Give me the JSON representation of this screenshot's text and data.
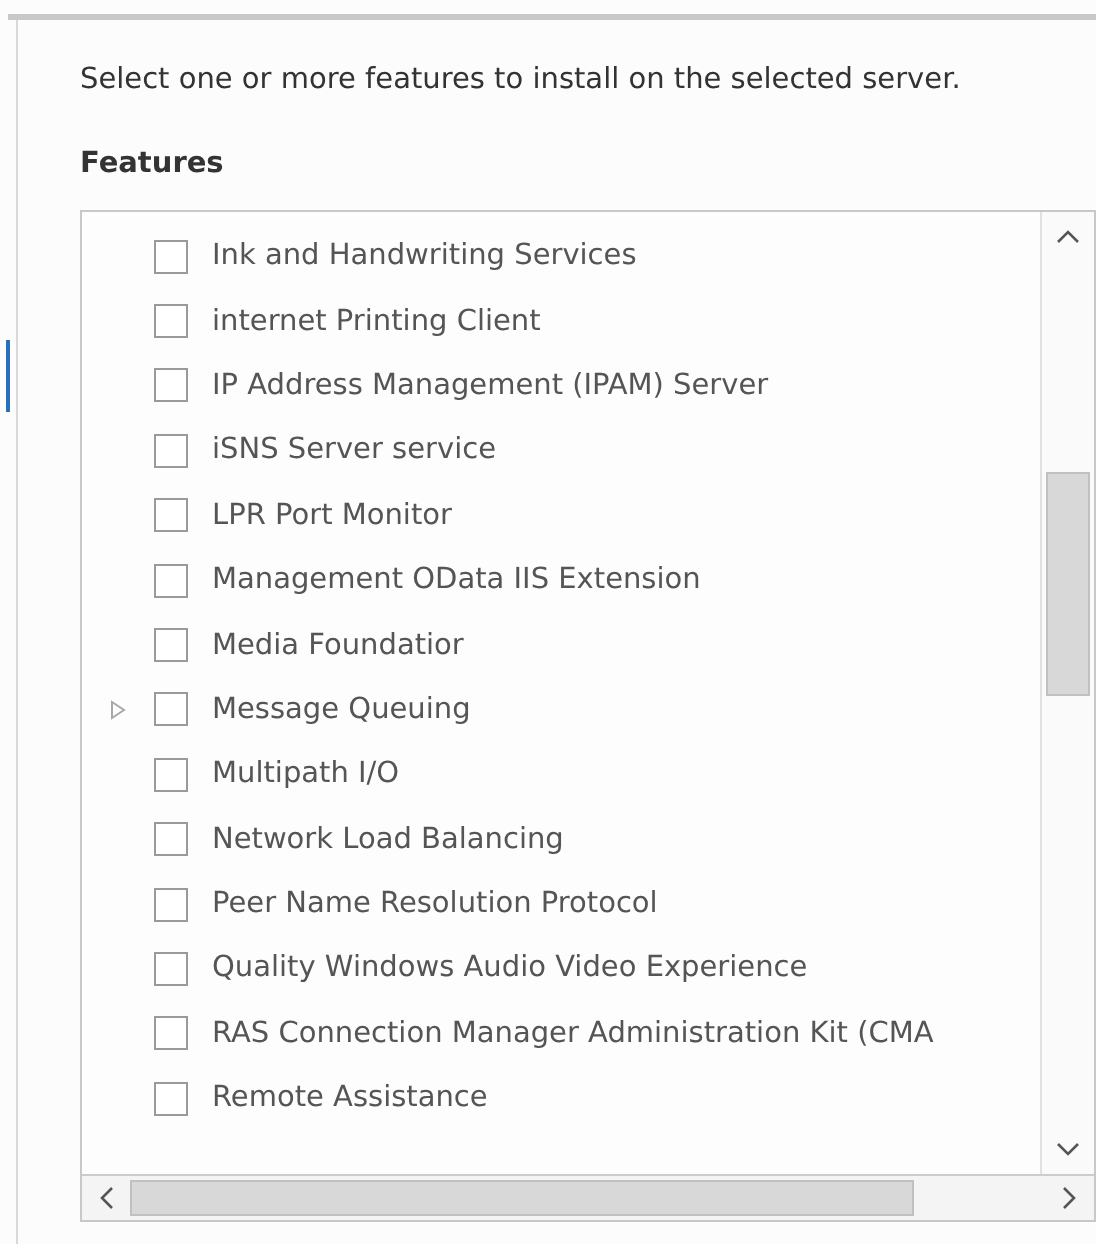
{
  "instruction": "Select one or more features to install on the selected server.",
  "features_heading": "Features",
  "features": [
    {
      "label": "Ink and Handwriting Services",
      "checked": false,
      "expandable": false
    },
    {
      "label": "internet Printing Client",
      "checked": false,
      "expandable": false
    },
    {
      "label": "IP Address Management (IPAM) Server",
      "checked": false,
      "expandable": false
    },
    {
      "label": "iSNS Server service",
      "checked": false,
      "expandable": false
    },
    {
      "label": "LPR Port Monitor",
      "checked": false,
      "expandable": false
    },
    {
      "label": "Management OData IIS Extension",
      "checked": false,
      "expandable": false
    },
    {
      "label": "Media Foundatior",
      "checked": false,
      "expandable": false
    },
    {
      "label": "Message Queuing",
      "checked": false,
      "expandable": true
    },
    {
      "label": "Multipath I/O",
      "checked": false,
      "expandable": false
    },
    {
      "label": "Network Load Balancing",
      "checked": false,
      "expandable": false
    },
    {
      "label": "Peer Name Resolution Protocol",
      "checked": false,
      "expandable": false
    },
    {
      "label": "Quality Windows Audio Video Experience",
      "checked": false,
      "expandable": false
    },
    {
      "label": "RAS Connection Manager Administration Kit (CMA",
      "checked": false,
      "expandable": false
    },
    {
      "label": "Remote Assistance",
      "checked": false,
      "expandable": false
    }
  ]
}
